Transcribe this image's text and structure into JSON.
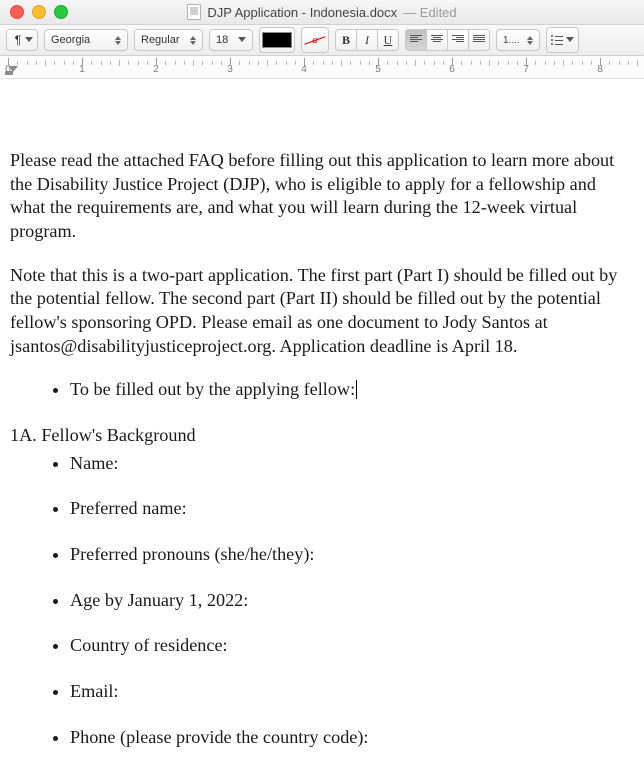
{
  "window": {
    "title_main": "DJP Application - Indonesia.docx",
    "title_suffix": "— Edited"
  },
  "toolbar": {
    "paragraph_sym": "¶",
    "font_family": "Georgia",
    "font_style": "Regular",
    "font_size": "18",
    "color_hex": "#000000",
    "linespacing_label": "1....",
    "bold_label": "B",
    "italic_label": "I",
    "underline_label": "U"
  },
  "ruler": {
    "labels": [
      "0",
      "1",
      "2",
      "3",
      "4",
      "5",
      "6",
      "7",
      "8"
    ]
  },
  "doc": {
    "para1": "Please read the attached FAQ before filling out this application to learn more about the Disability Justice Project (DJP), who is eligible to apply for a fellowship and what the requirements are, and what you will learn during the 12-week virtual program.",
    "para2": "Note that this is a two-part application. The first part (Part I) should be filled out by the potential fellow. The second part (Part II) should be filled out by the potential fellow's sponsoring OPD. Please email as one document to Jody Santos at jsantos@disabilityjusticeproject.org. Application deadline is April 18.",
    "bullet_intro": "To be filled out by the applying fellow:",
    "section_head": "1A. Fellow's Background",
    "fields": [
      "Name:",
      "Preferred name:",
      "Preferred pronouns (she/he/they):",
      "Age by January 1, 2022:",
      "Country of residence:",
      "Email:",
      "Phone (please provide the country code):"
    ]
  }
}
